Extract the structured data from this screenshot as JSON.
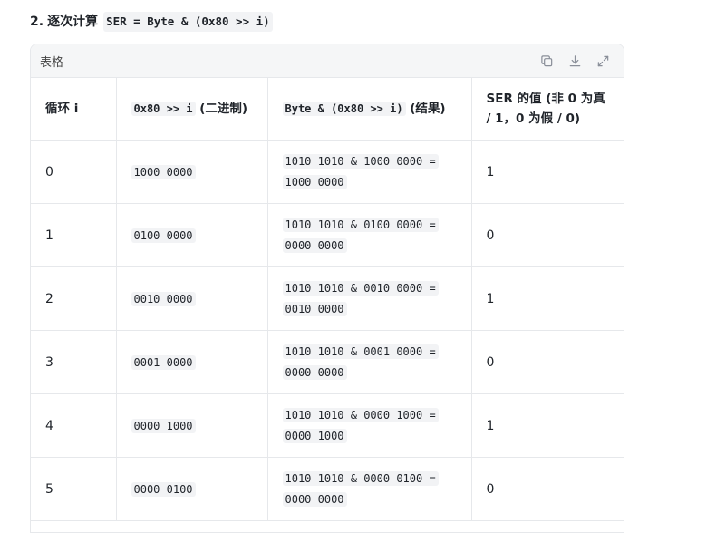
{
  "heading": {
    "number": "2.",
    "title": "逐次计算",
    "code": "SER = Byte & (0x80 >> i)"
  },
  "card": {
    "title": "表格",
    "actions": [
      {
        "name": "copy-icon"
      },
      {
        "name": "download-icon"
      },
      {
        "name": "expand-icon"
      }
    ]
  },
  "table": {
    "headers": {
      "col1": "循环 i",
      "col2_code": "0x80 >> i",
      "col2_text": "(二进制)",
      "col3_code": "Byte & (0x80 >> i)",
      "col3_text": "(结果)",
      "col4": "SER 的值 (非 0 为真 / 1，0 为假 / 0)"
    },
    "rows": [
      {
        "i": "0",
        "mask": "1000 0000",
        "expr": "1010 1010 & 1000 0000 = 1000 0000",
        "ser": "1"
      },
      {
        "i": "1",
        "mask": "0100 0000",
        "expr": "1010 1010 & 0100 0000 = 0000 0000",
        "ser": "0"
      },
      {
        "i": "2",
        "mask": "0010 0000",
        "expr": "1010 1010 & 0010 0000 = 0010 0000",
        "ser": "1"
      },
      {
        "i": "3",
        "mask": "0001 0000",
        "expr": "1010 1010 & 0001 0000 = 0000 0000",
        "ser": "0"
      },
      {
        "i": "4",
        "mask": "0000 1000",
        "expr": "1010 1010 & 0000 1000 = 0000 1000",
        "ser": "1"
      },
      {
        "i": "5",
        "mask": "0000 0100",
        "expr": "1010 1010 & 0000 0100 = 0000 0000",
        "ser": "0"
      }
    ]
  }
}
